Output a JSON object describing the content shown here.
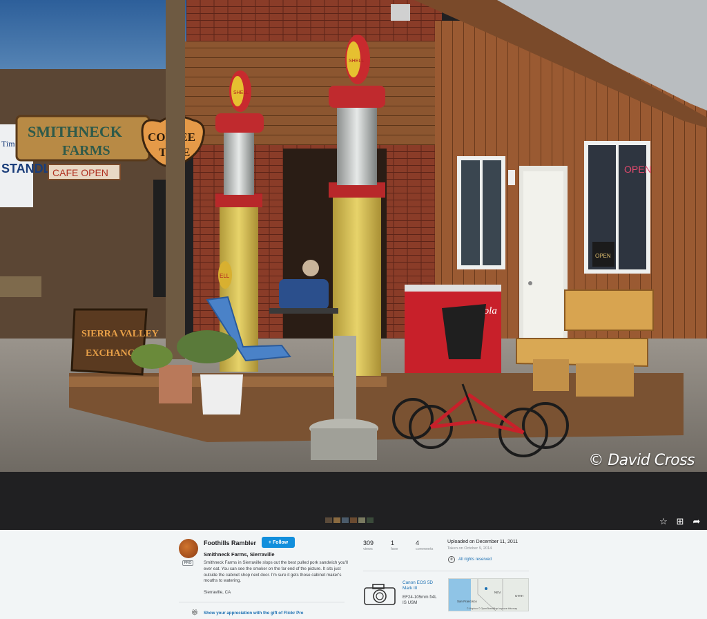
{
  "photo": {
    "watermark": "© David Cross",
    "sign_farm_line1": "SMITHNECK",
    "sign_farm_line2": "FARMS",
    "sign_coffee_line1": "COFFEE",
    "sign_coffee_line2": "TIME",
    "sign_cafe": "CAFE OPEN",
    "sign_sierra_line1": "SIERRA VALLEY",
    "sign_sierra_line2": "EXCHANGE",
    "pump_left_label": "SHELL",
    "pump_right_label": "SHELL",
    "pump_shell_side": "ELL",
    "cooler_label": "Coca-Cola",
    "window_sign_open": "OPEN",
    "window_neon": "OPEN",
    "left_sign_1": "STANDLEY",
    "left_sign_2": "Tim"
  },
  "filmstrip": {
    "thumb_colors": [
      "#5a4a3a",
      "#8a6a40",
      "#4a5a6a",
      "#6a4a30",
      "#7a7a60",
      "#3a4a3a"
    ]
  },
  "toolbar": {
    "fave_icon": "star-icon",
    "add_icon": "add-to-gallery-icon",
    "share_icon": "share-icon"
  },
  "author": {
    "name": "Foothills Rambler",
    "badge": "PRO",
    "follow_label": "Follow"
  },
  "post": {
    "title": "Smithneck Farms, Sierraville",
    "description": "Smithneck Farms in Sierraville slops out the best pulled pork sandwich you'll ever eat. You can see the smoker on the far end of the picture. It sits just outside the cabinet shop next door. I'm sure it gets those cabinet maker's mouths to watering.",
    "location": "Sierraville, CA",
    "gift_text": "Show your appreciation with the gift of Flickr Pro"
  },
  "stats": {
    "views": {
      "value": "309",
      "label": "views"
    },
    "faves": {
      "value": "1",
      "label": "fave"
    },
    "comments": {
      "value": "4",
      "label": "comments"
    }
  },
  "meta": {
    "uploaded": "Uploaded on December 11, 2011",
    "taken": "Taken on October 9, 2014",
    "rights": "All rights reserved",
    "camera": "Canon EOS 5D Mark III",
    "lens": "EF24-105mm f/4L IS USM"
  },
  "map": {
    "label_nev": "NEV.",
    "label_utah": "UTAH",
    "label_sf": "San Francisco",
    "credit": "© Mapbox © OpenStreetMap Improve this map"
  },
  "colors": {
    "accent": "#128fdc",
    "link": "#1a6fb2"
  }
}
